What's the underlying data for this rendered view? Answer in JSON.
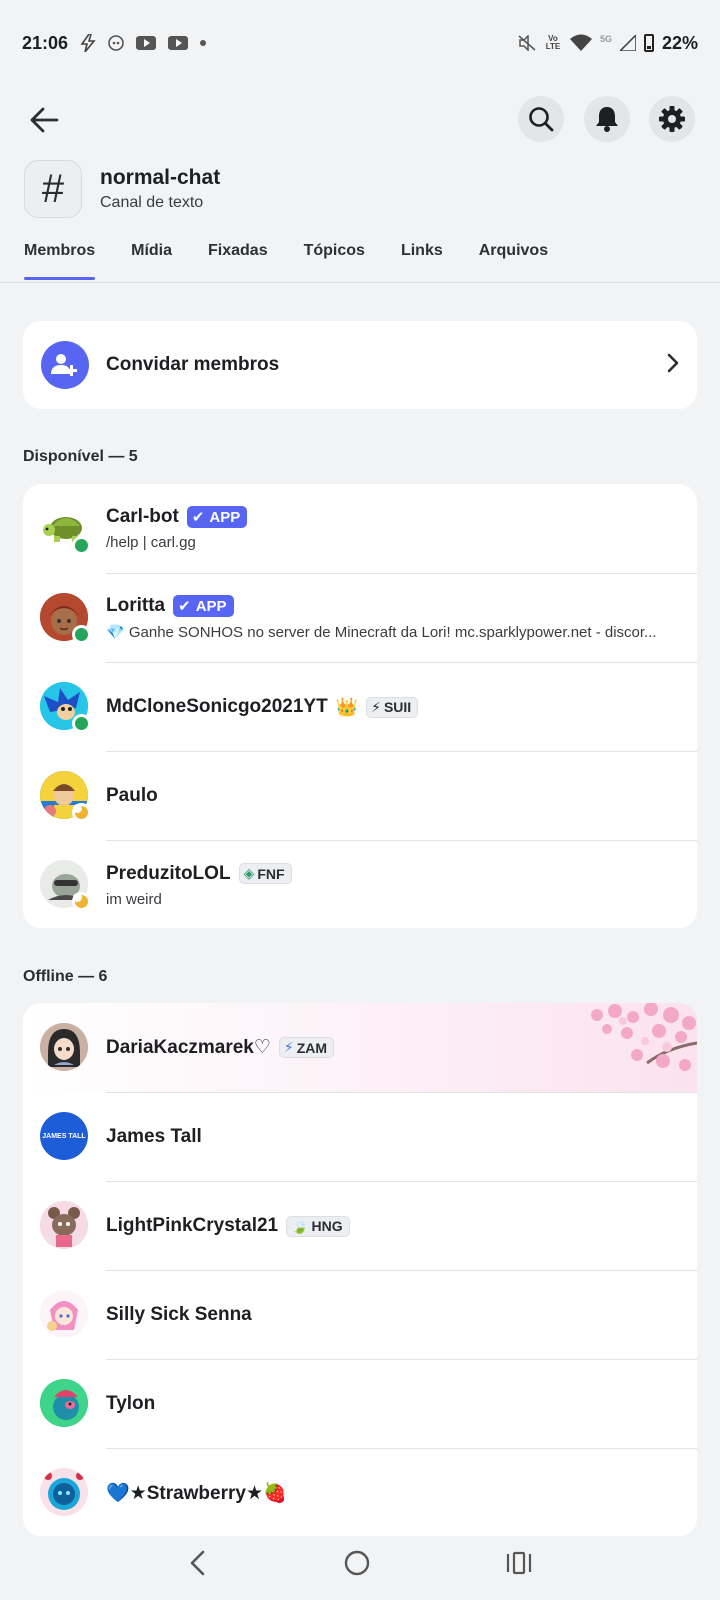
{
  "status_bar": {
    "time": "21:06",
    "battery": "22%",
    "icons": [
      "charging-bolt-icon",
      "discord-notif-icon",
      "youtube-icon",
      "youtube-icon",
      "dot-icon",
      "mute-icon",
      "volte-icon",
      "wifi-icon",
      "5g-icon",
      "signal-icon",
      "battery-icon"
    ],
    "volte_label": "Vo LTE",
    "fiveg_label": "5G"
  },
  "header": {
    "channel_symbol": "#",
    "channel_name": "normal-chat",
    "channel_type": "Canal de texto"
  },
  "tabs": [
    {
      "label": "Membros",
      "active": true
    },
    {
      "label": "Mídia",
      "active": false
    },
    {
      "label": "Fixadas",
      "active": false
    },
    {
      "label": "Tópicos",
      "active": false
    },
    {
      "label": "Links",
      "active": false
    },
    {
      "label": "Arquivos",
      "active": false
    }
  ],
  "invite": {
    "label": "Convidar membros"
  },
  "sections": {
    "online_header": "Disponível — 5",
    "offline_header": "Offline — 6"
  },
  "online_members": [
    {
      "name": "Carl-bot",
      "badge": "APP",
      "status": "/help | carl.gg",
      "presence": "online"
    },
    {
      "name": "Loritta",
      "badge": "APP",
      "status": "💎 Ganhe SONHOS no server de Minecraft da Lori! mc.sparklypower.net - discor...",
      "presence": "online"
    },
    {
      "name": "MdCloneSonicgo2021YT",
      "crown": "👑",
      "tag_icon": "⚡",
      "tag": "SUII",
      "presence": "online"
    },
    {
      "name": "Paulo",
      "presence": "idle"
    },
    {
      "name": "PreduzitoLOL",
      "tag_icon": "◈",
      "tag": "FNF",
      "status": "im weird",
      "presence": "idle"
    }
  ],
  "offline_members": [
    {
      "name": "DariaKaczmarek♡",
      "tag_icon": "⚡",
      "tag": "ZAM"
    },
    {
      "name": "James Tall",
      "avatar_text": "JAMES TALL"
    },
    {
      "name": "LightPinkCrystal21",
      "tag_icon": "🍃",
      "tag": "HNG"
    },
    {
      "name": "Silly Sick Senna"
    },
    {
      "name": "Tylon"
    },
    {
      "name": "💙★Strawberry★🍓"
    }
  ],
  "colors": {
    "accent": "#5865f2",
    "online": "#23a55a",
    "idle": "#f0b232",
    "background": "#f2f3f5"
  }
}
